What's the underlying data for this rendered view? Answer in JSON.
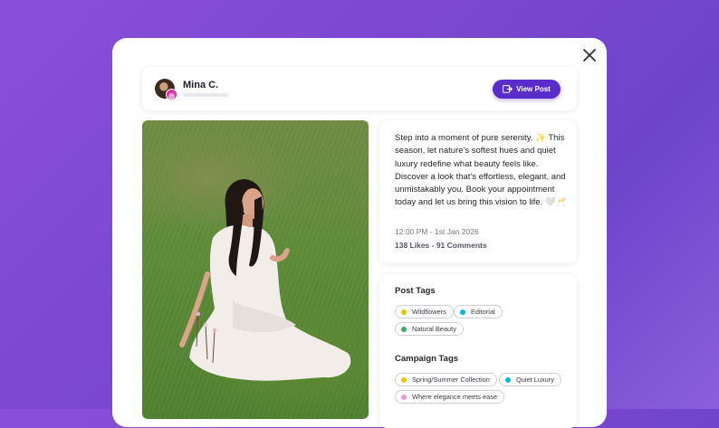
{
  "post": {
    "username": "Mina C.",
    "platform_icon": "instagram-icon",
    "view_post_label": "View Post",
    "caption": "Step into a moment of pure serenity. ✨ This season, let nature's softest hues and quiet luxury redefine what beauty feels like. Discover a look that's effortless, elegant, and unmistakably you. Book your appointment today and let us bring this vision to life. 🤍🥂",
    "timestamp": "12:00 PM - 1st Jan 2026",
    "stats": "138 Likes - 91 Comments"
  },
  "post_tags": {
    "title": "Post Tags",
    "tags": [
      {
        "label": "Wildflowers",
        "color": "#f2c300"
      },
      {
        "label": "Editorial",
        "color": "#11b5e4"
      },
      {
        "label": "Natural Beauty",
        "color": "#3fa968"
      }
    ]
  },
  "campaign_tags": {
    "title": "Campaign Tags",
    "tags": [
      {
        "label": "Spring/Summer Collection",
        "color": "#f2c300"
      },
      {
        "label": "Quiet Luxury",
        "color": "#11b5e4"
      },
      {
        "label": "Where elegance meets ease",
        "color": "#e99ad8"
      }
    ]
  },
  "colors": {
    "accent": "#5b2ccc",
    "instagram": "#e02fa4"
  }
}
